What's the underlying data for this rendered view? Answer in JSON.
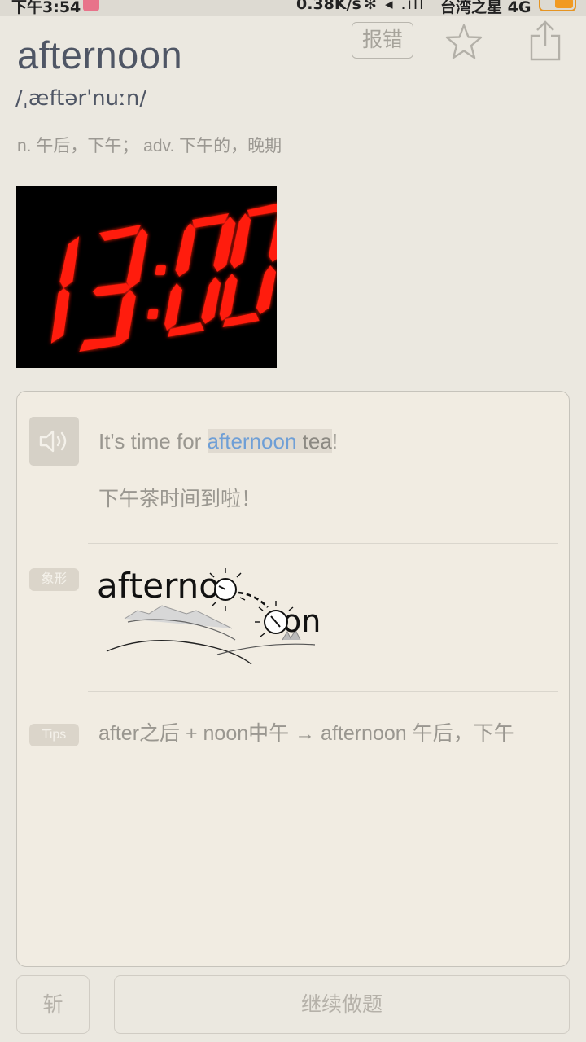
{
  "status_bar": {
    "time": "下午3:54",
    "net_speed": "0.38K/s",
    "signal_icons": "✻ ◂ .ıll",
    "carrier": "台湾之星 4G"
  },
  "word": {
    "headword": "afternoon",
    "phonetic": "/ˌæftərˈnuːn/",
    "definition": "n. 午后，下午； adv. 下午的，晚期",
    "report_label": "报错"
  },
  "clock_image": {
    "display": "13:00",
    "color": "#ff1a10"
  },
  "example": {
    "prefix": "It's time for ",
    "keyword": "afternoon",
    "rest": " tea",
    "suffix": "!",
    "translation": "下午茶时间到啦！"
  },
  "pictograph": {
    "tag": "象形",
    "part1": "afterno",
    "part2": "on"
  },
  "tips": {
    "tag": "Tips",
    "text": "after之后 + noon中午 → afternoon 午后，下午"
  },
  "actions": {
    "chop_label": "斩",
    "continue_label": "继续做题"
  },
  "icons": {
    "sound": "speaker-icon",
    "star": "star-icon",
    "share": "share-icon"
  }
}
